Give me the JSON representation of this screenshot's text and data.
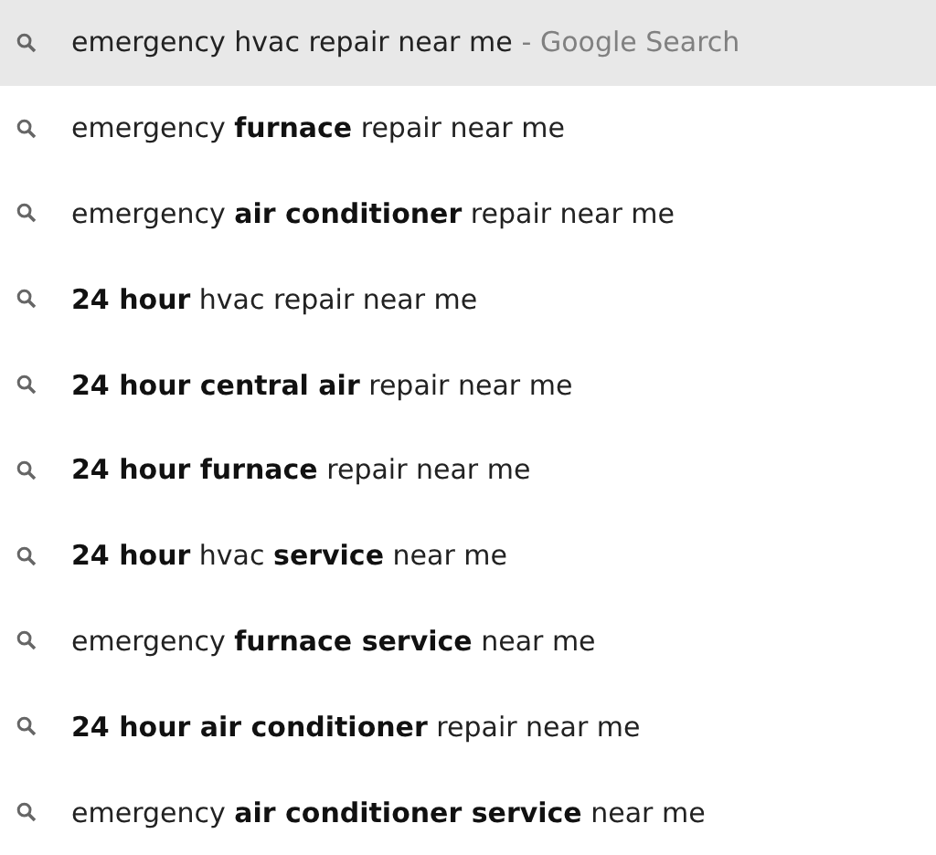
{
  "suggestions": [
    {
      "text": "emergency hvac repair near me",
      "suffix": "- Google Search",
      "selected": true
    },
    {
      "text": "emergency **furnace** repair near me",
      "selected": false
    },
    {
      "text": "emergency **air conditioner** repair near me",
      "selected": false
    },
    {
      "text": "**24 hour** hvac repair near me",
      "selected": false
    },
    {
      "text": "**24 hour central air** repair near me",
      "selected": false
    },
    {
      "text": "**24 hour furnace** repair near me",
      "selected": false
    },
    {
      "text": "**24 hour** hvac **service** near me",
      "selected": false
    },
    {
      "text": "emergency **furnace service** near me",
      "selected": false
    },
    {
      "text": "**24 hour air conditioner** repair near me",
      "selected": false
    },
    {
      "text": "emergency **air conditioner service** near me",
      "selected": false
    }
  ]
}
